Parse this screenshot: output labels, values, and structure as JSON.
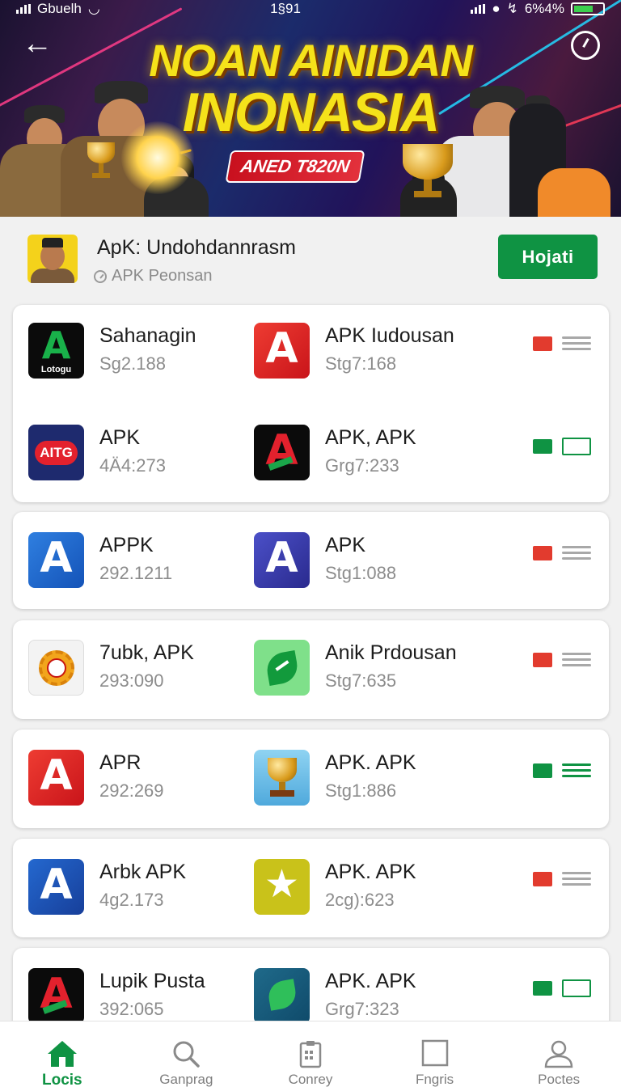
{
  "status_bar": {
    "left_text": "Gbuelh",
    "time": "1§91",
    "battery": "6%4%"
  },
  "banner": {
    "title_line1": "NOAN AINIDAN",
    "title_line2": "INONASIA",
    "tag": "ANED T820N",
    "back_icon": "arrow-left-icon",
    "timer_icon": "timer-icon"
  },
  "header": {
    "title": "ApK: Undohdannrasm",
    "subtitle": "APK Peonsan",
    "button": "Hojati"
  },
  "rows": [
    {
      "left": {
        "name": "Sahanagin",
        "size": "Sg2.188",
        "icon": "green-a-logo",
        "icon_label": "Lotogu"
      },
      "right": {
        "name": "APK Iudousan",
        "size": "Stg7:168",
        "icon": "red-a-logo"
      },
      "status_color": "#e23b2e",
      "control": "menu"
    },
    {
      "left": {
        "name": "APK",
        "size": "4Ä4:273",
        "icon": "aitg-logo",
        "icon_label": "AITG"
      },
      "right": {
        "name": "APK, APK",
        "size": "Grg7:233",
        "icon": "black-a-logo"
      },
      "status_color": "#0f9343",
      "control": "box"
    },
    {
      "left": {
        "name": "APPK",
        "size": "292.1211",
        "icon": "blue-a-logo"
      },
      "right": {
        "name": "APK",
        "size": "Stg1:088",
        "icon": "indigo-a-logo"
      },
      "status_color": "#e23b2e",
      "control": "menu"
    },
    {
      "left": {
        "name": "7ubk, APK",
        "size": "293:090",
        "icon": "gear-clock-logo"
      },
      "right": {
        "name": "Anik Prdousan",
        "size": "Stg7:635",
        "icon": "green-leaf-logo"
      },
      "status_color": "#e23b2e",
      "control": "menu"
    },
    {
      "left": {
        "name": "APR",
        "size": "292:269",
        "icon": "red-a-logo"
      },
      "right": {
        "name": "APK. APK",
        "size": "Stg1:886",
        "icon": "trophy-logo"
      },
      "status_color": "#0f9343",
      "control": "menu-green"
    },
    {
      "left": {
        "name": "Arbk APK",
        "size": "4g2.173",
        "icon": "blue-a-logo"
      },
      "right": {
        "name": "APK. APK",
        "size": "2cg):623",
        "icon": "yellow-star-logo"
      },
      "status_color": "#e23b2e",
      "control": "menu"
    },
    {
      "left": {
        "name": "Lupik Pusta",
        "size": "392:065",
        "icon": "black-a-logo"
      },
      "right": {
        "name": "APK. APK",
        "size": "Grg7:323",
        "icon": "teal-leaf-logo"
      },
      "status_color": "#0f9343",
      "control": "box"
    }
  ],
  "bottom_nav": [
    {
      "label": "Locis",
      "icon": "home-icon",
      "active": true
    },
    {
      "label": "Ganprag",
      "icon": "search-icon",
      "active": false
    },
    {
      "label": "Conrey",
      "icon": "clipboard-icon",
      "active": false
    },
    {
      "label": "Fngris",
      "icon": "square-icon",
      "active": false
    },
    {
      "label": "Poctes",
      "icon": "person-icon",
      "active": false
    }
  ],
  "colors": {
    "accent": "#0f9343",
    "danger": "#e23b2e",
    "banner_title": "#f5e21a"
  }
}
